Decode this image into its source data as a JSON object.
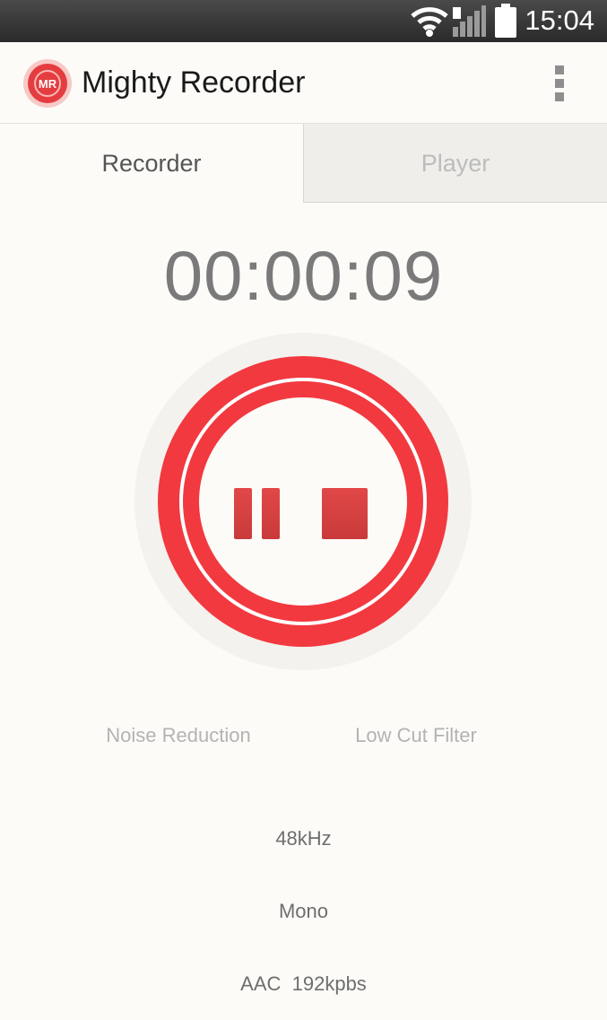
{
  "status_bar": {
    "time": "15:04",
    "icons": [
      "wifi-icon",
      "signal-icon",
      "battery-icon"
    ]
  },
  "app_bar": {
    "title": "Mighty Recorder",
    "logo_text": "MR",
    "menu_icon": "overflow-menu-icon"
  },
  "tabs": [
    {
      "label": "Recorder",
      "selected": true
    },
    {
      "label": "Player",
      "selected": false
    }
  ],
  "recorder": {
    "elapsed": "00:00:09",
    "controls": {
      "pause_icon": "pause-icon",
      "stop_icon": "stop-icon"
    },
    "options": {
      "noise_reduction": "Noise Reduction",
      "low_cut_filter": "Low Cut Filter"
    },
    "format": {
      "sample_rate": "48kHz",
      "channels": "Mono",
      "codec": "AAC  192kpbs"
    }
  },
  "colors": {
    "accent_red": "#f2393f",
    "status_bar_bg": "#333333",
    "background": "#fcfbf8",
    "inactive_tab_bg": "#efeeea"
  }
}
